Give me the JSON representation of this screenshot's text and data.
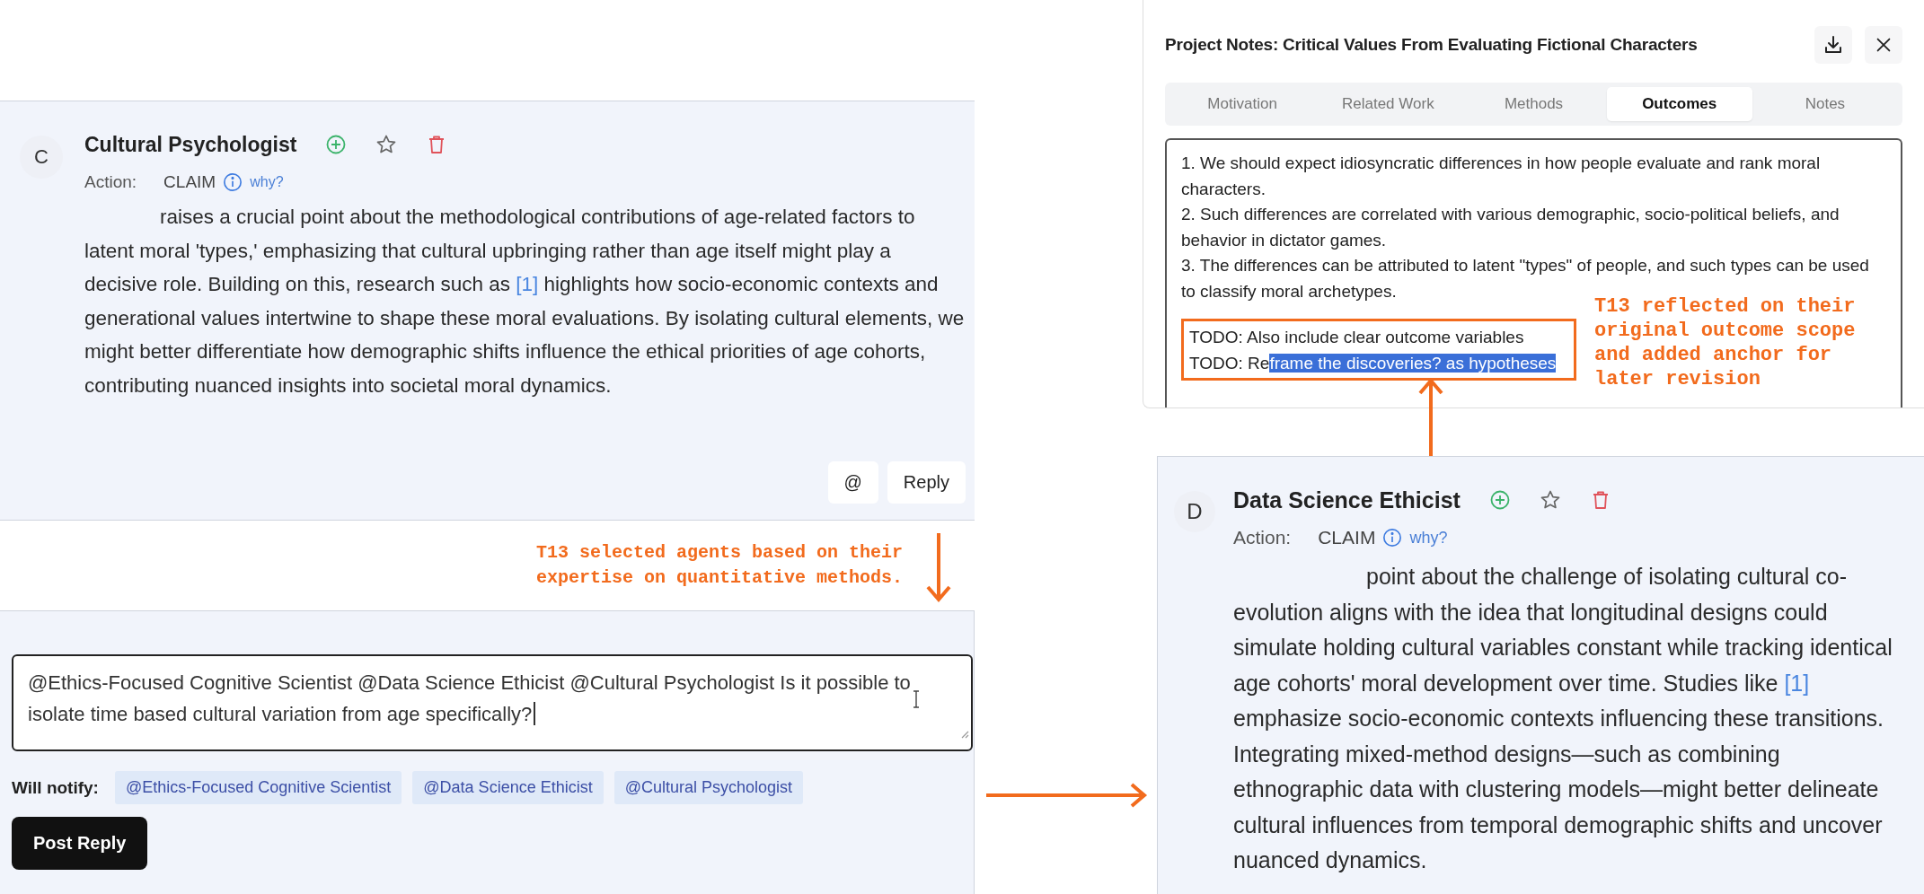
{
  "notes_panel": {
    "title": "Project Notes: Critical Values From Evaluating Fictional Characters",
    "tabs": [
      {
        "label": "Motivation",
        "selected": false
      },
      {
        "label": "Related Work",
        "selected": false
      },
      {
        "label": "Methods",
        "selected": false
      },
      {
        "label": "Outcomes",
        "selected": true
      },
      {
        "label": "Notes",
        "selected": false
      }
    ],
    "lines": [
      "1. We should expect idiosyncratic differences in how people evaluate and rank moral characters.",
      "2. Such differences are correlated with various demographic, socio-political beliefs, and behavior in  dictator games.",
      "3. The differences can be attributed to latent \"types\" of people, and such types can be used to classify moral archetypes."
    ],
    "todos": [
      {
        "text": "TODO: Also include clear outcome variables"
      },
      {
        "text": "TODO: Re",
        "selected_text": "frame the discoveries? as hypotheses"
      }
    ]
  },
  "annotations": [
    {
      "lines": [
        "T13 reflected on their",
        "original outcome scope",
        "and added anchor for",
        "later revision"
      ]
    },
    {
      "lines": [
        "T13 selected agents based on their",
        "expertise on quantitative methods."
      ]
    }
  ],
  "message_cards": [
    {
      "avatar": "C",
      "name": "Cultural Psychologist",
      "action_label": "Action:",
      "action": "CLAIM",
      "why": "why?",
      "body_parts": [
        {
          "kind": "text",
          "text": "raises a crucial point about the methodological contributions of age-related factors to latent moral 'types,' emphasizing that cultural upbringing rather than age itself might play a decisive role. Building on this, research such as "
        },
        {
          "kind": "citation",
          "text": "[1]"
        },
        {
          "kind": "text",
          "text": " highlights how socio-economic contexts and generational values intertwine to shape these moral evaluations. By isolating cultural elements, we might better differentiate how demographic shifts influence the ethical priorities of age cohorts, contributing nuanced insights into societal moral dynamics."
        }
      ],
      "buttons": [
        "@",
        "Reply"
      ]
    },
    {
      "avatar": "D",
      "name": "Data Science Ethicist",
      "action_label": "Action:",
      "action": "CLAIM",
      "why": "why?",
      "body_parts": [
        {
          "kind": "text",
          "text": "point about the challenge of isolating cultural co-evolution aligns with the idea that longitudinal designs could simulate holding cultural variables constant while tracking identical age cohorts' moral development over time. Studies like "
        },
        {
          "kind": "citation",
          "text": "[1]"
        },
        {
          "kind": "text",
          "text": " emphasize socio-economic contexts influencing these transitions. Integrating mixed-method designs—such as combining ethnographic data with clustering models—might better delineate cultural influences from temporal demographic shifts and uncover nuanced dynamics."
        }
      ]
    }
  ],
  "composer": {
    "message": "@Ethics-Focused Cognitive Scientist @Data Science Ethicist @Cultural Psychologist Is it possible to isolate time based cultural variation from age specifically?",
    "notify_label": "Will notify:",
    "recipients": [
      "@Ethics-Focused Cognitive Scientist",
      "@Data Science Ethicist",
      "@Cultural Psychologist"
    ],
    "submit": "Post Reply"
  }
}
